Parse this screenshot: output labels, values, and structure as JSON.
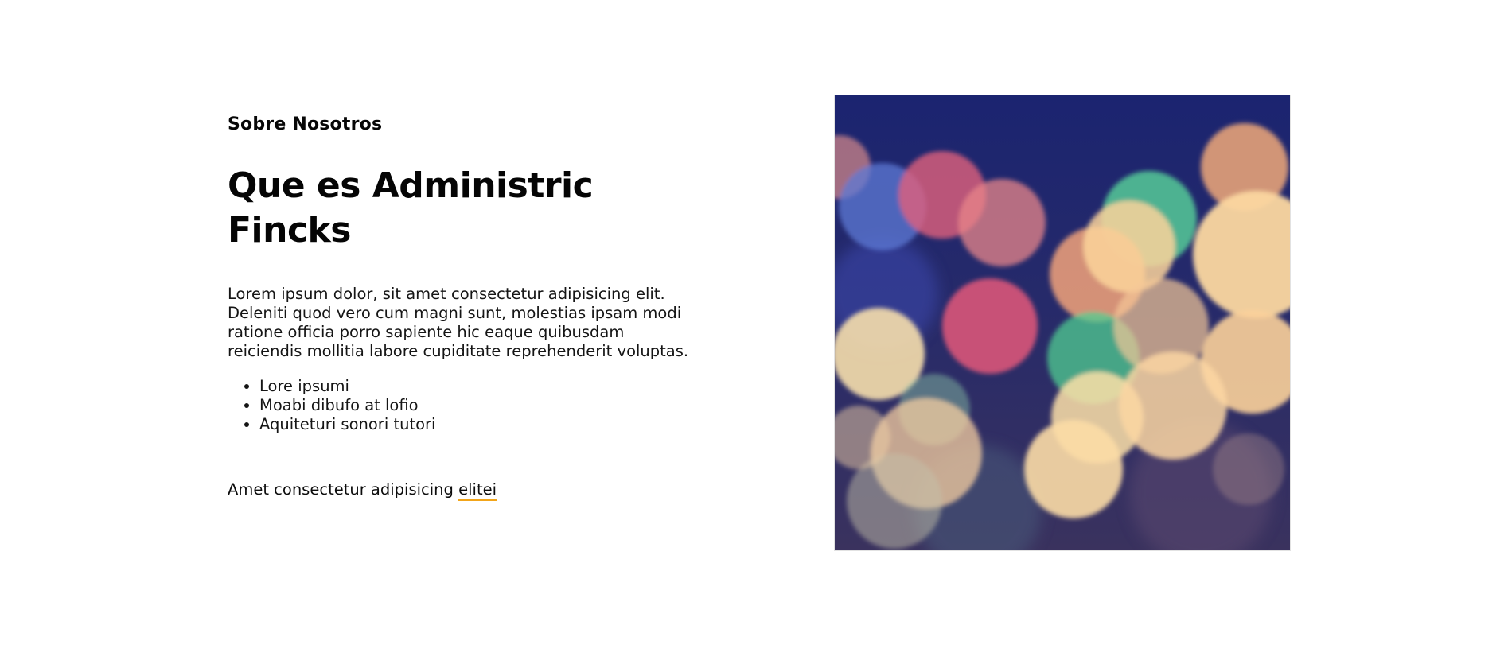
{
  "about": {
    "eyebrow": "Sobre Nosotros",
    "headline": "Que es Administric Fincks",
    "body": "Lorem ipsum dolor, sit amet consectetur adipisicing elit. Deleniti quod vero cum magni sunt, molestias ipsam modi ratione officia porro sapiente hic eaque quibusdam reiciendis mollitia labore cupiditate reprehenderit voluptas.",
    "features": [
      "Lore ipsumi",
      "Moabi dibufo at lofio",
      "Aquiteturi sonori tutori"
    ],
    "tagline_text": "Amet consectetur adipisicing ",
    "tagline_link": "elitei"
  },
  "image": {
    "subject": "bokeh-lights-photo"
  },
  "colors": {
    "link_underline": "#f2a51a",
    "text": "#0b0b0b",
    "background": "#ffffff"
  }
}
